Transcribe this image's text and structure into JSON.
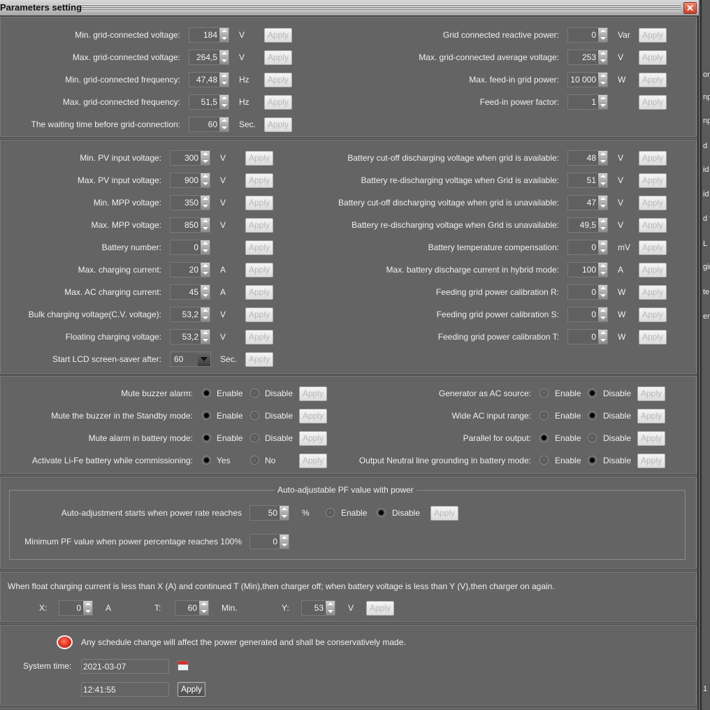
{
  "window": {
    "title": "Parameters setting",
    "close_icon": "close-icon"
  },
  "apply_label": "Apply",
  "grid": {
    "left": [
      {
        "label": "Min. grid-connected voltage:",
        "value": "184",
        "unit": "V"
      },
      {
        "label": "Max. grid-connected voltage:",
        "value": "264,5",
        "unit": "V"
      },
      {
        "label": "Min. grid-connected frequency:",
        "value": "47,48",
        "unit": "Hz"
      },
      {
        "label": "Max. grid-connected frequency:",
        "value": "51,5",
        "unit": "Hz"
      },
      {
        "label": "The waiting time before grid-connection:",
        "value": "60",
        "unit": "Sec."
      }
    ],
    "right": [
      {
        "label": "Grid connected reactive power:",
        "value": "0",
        "unit": "Var"
      },
      {
        "label": "Max. grid-connected average voltage:",
        "value": "253",
        "unit": "V"
      },
      {
        "label": "Max. feed-in grid power:",
        "value": "10 000",
        "unit": "W"
      },
      {
        "label": "Feed-in power factor:",
        "value": "1",
        "unit": ""
      }
    ]
  },
  "battery": {
    "left": [
      {
        "label": "Min. PV input voltage:",
        "value": "300",
        "unit": "V"
      },
      {
        "label": "Max. PV input voltage:",
        "value": "900",
        "unit": "V"
      },
      {
        "label": "Min. MPP voltage:",
        "value": "350",
        "unit": "V"
      },
      {
        "label": "Max. MPP voltage:",
        "value": "850",
        "unit": "V"
      },
      {
        "label": "Battery number:",
        "value": "0",
        "unit": ""
      },
      {
        "label": "Max. charging current:",
        "value": "20",
        "unit": "A"
      },
      {
        "label": "Max. AC charging current:",
        "value": "45",
        "unit": "A"
      },
      {
        "label": "Bulk charging voltage(C.V. voltage):",
        "value": "53,2",
        "unit": "V"
      },
      {
        "label": "Floating charging voltage:",
        "value": "53,2",
        "unit": "V"
      },
      {
        "label": "Start LCD screen-saver after:",
        "value": "60",
        "unit": "Sec.",
        "combo": true
      }
    ],
    "right": [
      {
        "label": "Battery cut-off discharging voltage when grid is available:",
        "value": "48",
        "unit": "V"
      },
      {
        "label": "Battery re-discharging voltage when Grid is available:",
        "value": "51",
        "unit": "V"
      },
      {
        "label": "Battery cut-off discharging voltage when grid is unavailable:",
        "value": "47",
        "unit": "V"
      },
      {
        "label": "Battery re-discharging voltage when Grid is unavailable:",
        "value": "49,5",
        "unit": "V"
      },
      {
        "label": "Battery temperature compensation:",
        "value": "0",
        "unit": "mV"
      },
      {
        "label": "Max. battery discharge current in hybrid mode:",
        "value": "100",
        "unit": "A"
      },
      {
        "label": "Feeding grid power calibration R:",
        "value": "0",
        "unit": "W"
      },
      {
        "label": "Feeding grid power calibration S:",
        "value": "0",
        "unit": "W"
      },
      {
        "label": "Feeding grid power calibration T:",
        "value": "0",
        "unit": "W"
      }
    ]
  },
  "options": {
    "left": [
      {
        "label": "Mute buzzer alarm:",
        "opt1": "Enable",
        "opt2": "Disable",
        "selected": 1
      },
      {
        "label": "Mute the buzzer in the Standby mode:",
        "opt1": "Enable",
        "opt2": "Disable",
        "selected": 1
      },
      {
        "label": "Mute alarm in battery mode:",
        "opt1": "Enable",
        "opt2": "Disable",
        "selected": 1
      },
      {
        "label": "Activate Li-Fe battery while commissioning:",
        "opt1": "Yes",
        "opt2": "No",
        "selected": 1
      }
    ],
    "right": [
      {
        "label": "Generator as AC source:",
        "opt1": "Enable",
        "opt2": "Disable",
        "selected": 2
      },
      {
        "label": "Wide AC input range:",
        "opt1": "Enable",
        "opt2": "Disable",
        "selected": 2
      },
      {
        "label": "Parallel for output:",
        "opt1": "Enable",
        "opt2": "Disable",
        "selected": 1
      },
      {
        "label": "Output Neutral line grounding in battery mode:",
        "opt1": "Enable",
        "opt2": "Disable",
        "selected": 2
      }
    ]
  },
  "pf": {
    "legend": "Auto-adjustable PF value with power",
    "start_label": "Auto-adjustment starts when power rate reaches",
    "start_value": "50",
    "start_unit": "%",
    "opt1": "Enable",
    "opt2": "Disable",
    "selected": 2,
    "min_label": "Minimum PF value when power percentage reaches 100%",
    "min_value": "0"
  },
  "float": {
    "description": "When float charging current is less than X (A) and continued T (Min),then charger off; when battery voltage is less than Y (V),then charger on again.",
    "x_label": "X:",
    "x_value": "0",
    "x_unit": "A",
    "t_label": "T:",
    "t_value": "60",
    "t_unit": "Min.",
    "y_label": "Y:",
    "y_value": "53",
    "y_unit": "V"
  },
  "schedule": {
    "warning": "Any schedule change will affect the power generated and shall be conservatively made.",
    "warning_color": "#e03020",
    "system_time_label": "System time:",
    "date": "2021-03-07",
    "time": "12:41:55"
  },
  "background_window_fragments": [
    "orr",
    "npu",
    "npu",
    "d",
    "id",
    "id",
    "d f",
    "L",
    "gin",
    "te",
    "ery",
    "1"
  ]
}
